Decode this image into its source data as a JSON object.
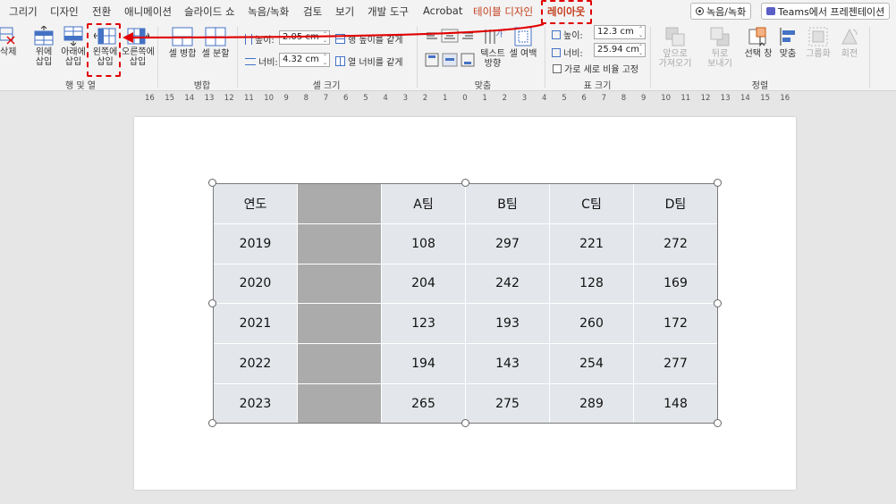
{
  "tabs": [
    {
      "label": "그리기"
    },
    {
      "label": "디자인"
    },
    {
      "label": "전환"
    },
    {
      "label": "애니메이션"
    },
    {
      "label": "슬라이드 쇼"
    },
    {
      "label": "녹음/녹화"
    },
    {
      "label": "검토"
    },
    {
      "label": "보기"
    },
    {
      "label": "개발 도구"
    },
    {
      "label": "Acrobat"
    },
    {
      "label": "테이블 디자인"
    },
    {
      "label": "레이아웃"
    }
  ],
  "top_buttons": {
    "record": "녹음/녹화",
    "teams": "Teams에서 프레젠테이션"
  },
  "ribbon": {
    "rows_cols": {
      "delete": "삭제",
      "insert_above_1": "위에",
      "insert_above_2": "삽입",
      "insert_below_1": "아래에",
      "insert_below_2": "삽입",
      "insert_left_1": "왼쪽에",
      "insert_left_2": "삽입",
      "insert_right_1": "오른쪽에",
      "insert_right_2": "삽입",
      "group_label": "행 및 열"
    },
    "merge": {
      "merge_cells": "셀 병합",
      "split_cells": "셀 분할",
      "group_label": "병합"
    },
    "cell_size": {
      "height_label": "높이:",
      "height_value": "2.05 cm",
      "width_label": "너비:",
      "width_value": "4.32 cm",
      "distribute_rows": "행 높이를 같게",
      "distribute_cols": "열 너비를 같게",
      "group_label": "셀 크기"
    },
    "alignment": {
      "text_direction_1": "텍스트",
      "text_direction_2": "방향",
      "cell_margins_1": "셀 여백",
      "group_label": "맞춤"
    },
    "table_size": {
      "height_label": "높이:",
      "height_value": "12.3 cm",
      "width_label": "너비:",
      "width_value": "25.94 cm",
      "lock_ratio": "가로 세로 비율 고정",
      "group_label": "표 크기"
    },
    "arrange": {
      "bring_forward_1": "앞으로",
      "bring_forward_2": "가져오기",
      "send_backward_1": "뒤로",
      "send_backward_2": "보내기",
      "selection_pane": "선택 창",
      "align": "맞춤",
      "group": "그룹화",
      "rotate": "회전",
      "group_label": "정렬"
    }
  },
  "ruler_labels": [
    "16",
    "15",
    "14",
    "13",
    "12",
    "11",
    "10",
    "9",
    "8",
    "7",
    "6",
    "5",
    "4",
    "3",
    "2",
    "1",
    "0",
    "1",
    "2",
    "3",
    "4",
    "5",
    "6",
    "7",
    "8",
    "9",
    "10",
    "11",
    "12",
    "13",
    "14",
    "15",
    "16"
  ],
  "table": {
    "header": [
      "연도",
      "",
      "A팀",
      "B팀",
      "C팀",
      "D팀"
    ],
    "rows": [
      [
        "2019",
        "",
        "108",
        "297",
        "221",
        "272"
      ],
      [
        "2020",
        "",
        "204",
        "242",
        "128",
        "169"
      ],
      [
        "2021",
        "",
        "123",
        "193",
        "260",
        "172"
      ],
      [
        "2022",
        "",
        "194",
        "143",
        "254",
        "277"
      ],
      [
        "2023",
        "",
        "265",
        "275",
        "289",
        "148"
      ]
    ]
  },
  "colors": {
    "accent": "#c43e1c",
    "highlight": "#e00000",
    "inserted_column": "#ababab",
    "cell": "#e3e6ea"
  }
}
